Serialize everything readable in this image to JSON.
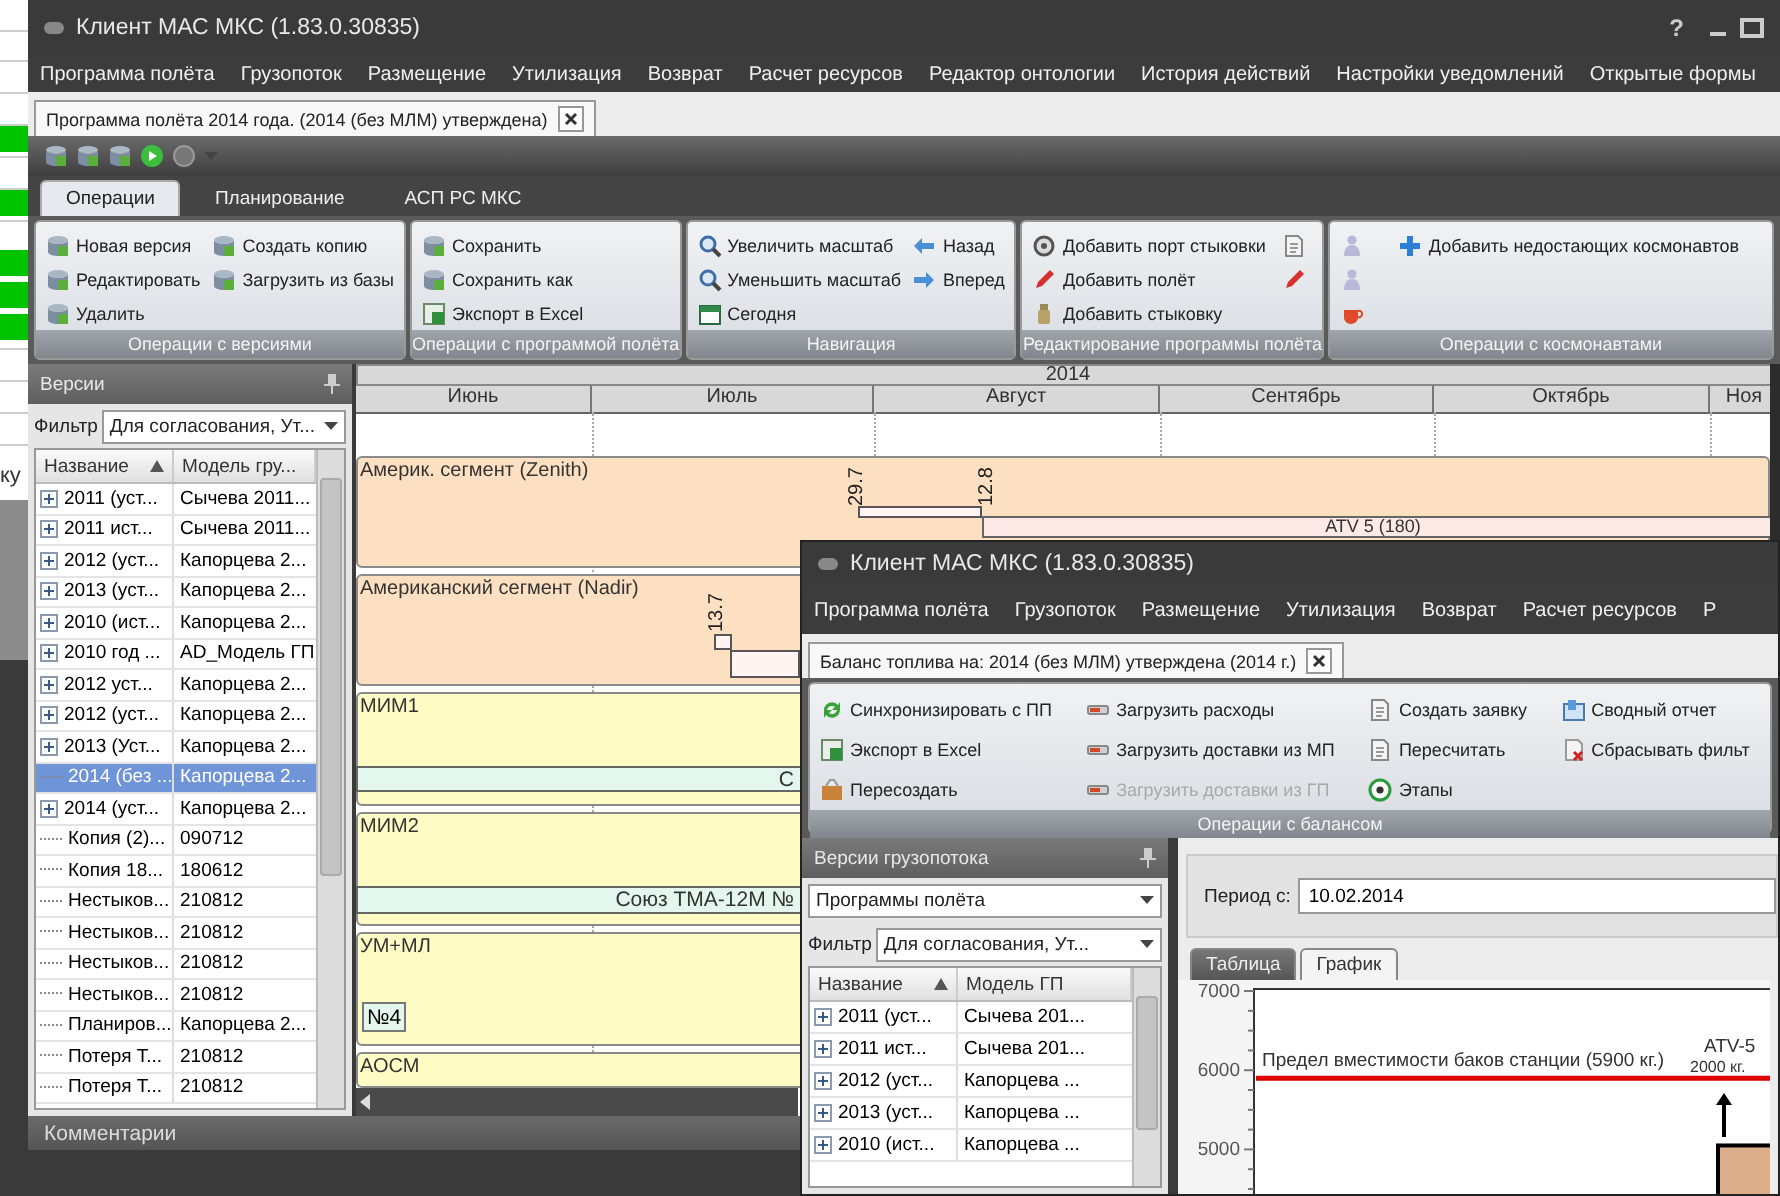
{
  "background_sheet": {
    "fragment": "ку"
  },
  "main_window": {
    "title": "Клиент МАС МКС (1.83.0.30835)",
    "help_button": "?",
    "menu": [
      "Программа полёта",
      "Грузопоток",
      "Размещение",
      "Утилизация",
      "Возврат",
      "Расчет ресурсов",
      "Редактор онтологии",
      "История действий",
      "Настройки уведомлений",
      "Открытые формы"
    ],
    "document_tab": {
      "label": "Программа полёта 2014 года. (2014 (без МЛМ) утверждена)"
    },
    "ribbon_tabs": [
      {
        "label": "Операции",
        "selected": true
      },
      {
        "label": "Планирование",
        "selected": false
      },
      {
        "label": "АСП РС МКС",
        "selected": false
      }
    ],
    "ribbon_groups": [
      {
        "caption": "Операции с версиями",
        "buttons": [
          {
            "kind": "text",
            "label": "Новая версия"
          },
          {
            "kind": "text",
            "label": "Редактировать"
          },
          {
            "kind": "text",
            "label": "Удалить"
          },
          {
            "kind": "text",
            "label": "Создать копию"
          },
          {
            "kind": "text",
            "label": "Загрузить из базы"
          }
        ]
      },
      {
        "caption": "Операции с программой полёта",
        "buttons": [
          {
            "kind": "text",
            "label": "Сохранить"
          },
          {
            "kind": "text",
            "label": "Сохранить как"
          },
          {
            "kind": "text",
            "label": "Экспорт в Excel"
          }
        ]
      },
      {
        "caption": "Навигация",
        "buttons": [
          {
            "kind": "text",
            "label": "Увеличить масштаб"
          },
          {
            "kind": "text",
            "label": "Уменьшить масштаб"
          },
          {
            "kind": "text",
            "label": "Сегодня"
          },
          {
            "kind": "text",
            "label": "Назад"
          },
          {
            "kind": "text",
            "label": "Вперед"
          }
        ]
      },
      {
        "caption": "Редактирование программы полёта",
        "buttons": [
          {
            "kind": "text",
            "label": "Добавить порт стыковки"
          },
          {
            "kind": "text",
            "label": "Добавить полёт"
          },
          {
            "kind": "text",
            "label": "Добавить стыковку"
          },
          {
            "kind": "icon"
          },
          {
            "kind": "icon"
          }
        ]
      },
      {
        "caption": "Операции с космонавтами",
        "buttons": [
          {
            "kind": "icon"
          },
          {
            "kind": "icon"
          },
          {
            "kind": "icon"
          },
          {
            "kind": "text",
            "label": "Добавить недостающих космонавтов"
          }
        ]
      }
    ],
    "versions_panel": {
      "title": "Версии",
      "filter_label": "Фильтр",
      "filter_value": "Для согласования, Ут...",
      "columns": [
        {
          "label": "Название",
          "sorted": true
        },
        {
          "label": "Модель гру...",
          "sorted": false
        }
      ],
      "rows": [
        {
          "name": "2011 (уст...",
          "model": "Сычева 2011...",
          "has_children": true,
          "selected": false
        },
        {
          "name": "2011 ист...",
          "model": "Сычева 2011...",
          "has_children": true,
          "selected": false
        },
        {
          "name": "2012 (уст...",
          "model": "Капорцева 2...",
          "has_children": true,
          "selected": false
        },
        {
          "name": "2013 (уст...",
          "model": "Капорцева 2...",
          "has_children": true,
          "selected": false
        },
        {
          "name": "2010 (ист...",
          "model": "Капорцева 2...",
          "has_children": true,
          "selected": false
        },
        {
          "name": "2010 год ...",
          "model": "AD_Модель ГП",
          "has_children": true,
          "selected": false
        },
        {
          "name": "2012  уст...",
          "model": "Капорцева 2...",
          "has_children": true,
          "selected": false
        },
        {
          "name": "2012 (уст...",
          "model": "Капорцева 2...",
          "has_children": true,
          "selected": false
        },
        {
          "name": "2013 (Уст...",
          "model": "Капорцева 2...",
          "has_children": true,
          "selected": false
        },
        {
          "name": "2014 (без ...",
          "model": "Капорцева 2...",
          "has_children": false,
          "selected": true
        },
        {
          "name": "2014 (уст...",
          "model": "Капорцева 2...",
          "has_children": true,
          "selected": false
        },
        {
          "name": "Копия (2)...",
          "model": "090712",
          "has_children": false,
          "selected": false
        },
        {
          "name": "Копия 18...",
          "model": "180612",
          "has_children": false,
          "selected": false
        },
        {
          "name": "Нестыков...",
          "model": "210812",
          "has_children": false,
          "selected": false
        },
        {
          "name": "Нестыков...",
          "model": "210812",
          "has_children": false,
          "selected": false
        },
        {
          "name": "Нестыков...",
          "model": "210812",
          "has_children": false,
          "selected": false
        },
        {
          "name": "Нестыков...",
          "model": "210812",
          "has_children": false,
          "selected": false
        },
        {
          "name": "Планиров...",
          "model": "Капорцева 2...",
          "has_children": false,
          "selected": false
        },
        {
          "name": "Потеря Т...",
          "model": "210812",
          "has_children": false,
          "selected": false
        },
        {
          "name": "Потеря Т...",
          "model": "210812",
          "has_children": false,
          "selected": false
        }
      ]
    },
    "gantt": {
      "year": "2014",
      "months": [
        "Июнь",
        "Июль",
        "Август",
        "Сентябрь",
        "Октябрь",
        "Ноя"
      ],
      "lanes": [
        {
          "name": "Америк. сегмент (Zenith)",
          "color": "#fde0c2",
          "items": [
            {
              "kind": "date",
              "text": "29.7"
            },
            {
              "kind": "date",
              "text": "12.8"
            },
            {
              "kind": "slot"
            },
            {
              "kind": "flight",
              "text": "ATV 5 (180)",
              "color": "#fdeae6"
            }
          ]
        },
        {
          "name": "Американский сегмент (Nadir)",
          "color": "#fde0c2",
          "items": [
            {
              "kind": "date",
              "text": "13.7"
            },
            {
              "kind": "slot"
            },
            {
              "kind": "slot"
            }
          ]
        },
        {
          "name": "МИМ1",
          "color": "#fefbc4",
          "items": [
            {
              "kind": "flight",
              "text": "С",
              "color": "#e4f7ef"
            }
          ]
        },
        {
          "name": "МИМ2",
          "color": "#fefbc4",
          "items": [
            {
              "kind": "flight",
              "text": "Союз ТМА-12М №",
              "color": "#e4f7ef"
            }
          ]
        },
        {
          "name": "УМ+МЛ",
          "color": "#fefbc4",
          "items": [
            {
              "kind": "tag",
              "text": "№4"
            }
          ]
        },
        {
          "name": "АОСМ",
          "color": "#fefbc4"
        }
      ]
    },
    "comments_panel": {
      "title": "Комментарии"
    }
  },
  "balance_window": {
    "title": "Клиент МАС МКС (1.83.0.30835)",
    "menu": [
      "Программа полёта",
      "Грузопоток",
      "Размещение",
      "Утилизация",
      "Возврат",
      "Расчет ресурсов",
      "Р"
    ],
    "document_tab": {
      "label": "Баланс топлива на: 2014 (без МЛМ) утверждена (2014 г.)"
    },
    "ribbon_group": {
      "caption": "Операции  с балансом",
      "buttons": [
        {
          "label": "Синхронизировать с ПП",
          "disabled": false
        },
        {
          "label": "Экспорт в Excel",
          "disabled": false
        },
        {
          "label": "Пересоздать",
          "disabled": false
        },
        {
          "label": "Загрузить расходы",
          "disabled": false
        },
        {
          "label": "Загрузить доставки из МП",
          "disabled": false
        },
        {
          "label": "Загрузить доставки из ГП",
          "disabled": true
        },
        {
          "label": "Создать заявку",
          "disabled": false
        },
        {
          "label": "Пересчитать",
          "disabled": false
        },
        {
          "label": "Этапы",
          "disabled": false
        },
        {
          "label": "Сводный отчет",
          "disabled": false
        },
        {
          "label": "Сбрасывать фильт",
          "disabled": false
        }
      ]
    },
    "versions_panel": {
      "title": "Версии грузопотока",
      "source_value": "Программы полёта",
      "filter_label": "Фильтр",
      "filter_value": "Для согласования, Ут...",
      "columns": [
        {
          "label": "Название",
          "sorted": true
        },
        {
          "label": "Модель ГП",
          "sorted": false
        }
      ],
      "rows": [
        {
          "name": "2011 (уст...",
          "model": "Сычева 201...",
          "has_children": true,
          "selected": false
        },
        {
          "name": "2011 ист...",
          "model": "Сычева 201...",
          "has_children": true,
          "selected": false
        },
        {
          "name": "2012 (уст...",
          "model": "Капорцева ...",
          "has_children": true,
          "selected": false
        },
        {
          "name": "2013 (уст...",
          "model": "Капорцева ...",
          "has_children": true,
          "selected": false
        },
        {
          "name": "2010 (ист...",
          "model": "Капорцева ...",
          "has_children": true,
          "selected": false
        }
      ]
    },
    "period": {
      "label": "Период с:",
      "value": "10.02.2014"
    },
    "view_tabs": [
      {
        "label": "Таблица",
        "selected": false
      },
      {
        "label": "График",
        "selected": true
      }
    ],
    "chart_data": {
      "type": "bar",
      "categories": [
        "ATV-5"
      ],
      "values": [
        5050
      ],
      "ylim": [
        4450,
        7000
      ],
      "yticks": [
        5000,
        6000,
        7000
      ],
      "ref_lines": [
        {
          "axis": "y",
          "value": 5900,
          "label": "Предел вместимости баков станции (5900 кг.)",
          "color": "#e00000"
        }
      ],
      "annotations": [
        "2000 кг."
      ]
    }
  }
}
